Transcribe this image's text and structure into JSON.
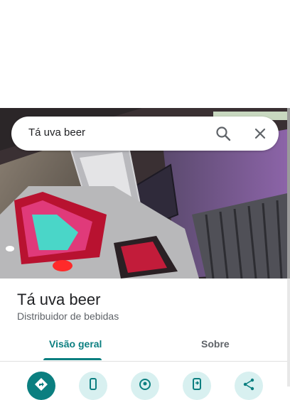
{
  "search": {
    "query": "Tá uva beer"
  },
  "place": {
    "name": "Tá uva beer",
    "category": "Distribuidor de bebidas"
  },
  "tabs": [
    {
      "label": "Visão geral",
      "active": true
    },
    {
      "label": "Sobre",
      "active": false
    }
  ],
  "colors": {
    "accent": "#0b7f80",
    "action_bg": "#d8f0f0"
  },
  "actions": [
    {
      "icon": "directions-icon"
    },
    {
      "icon": "phone-icon"
    },
    {
      "icon": "nearby-icon"
    },
    {
      "icon": "send-to-phone-icon"
    },
    {
      "icon": "share-icon"
    }
  ]
}
